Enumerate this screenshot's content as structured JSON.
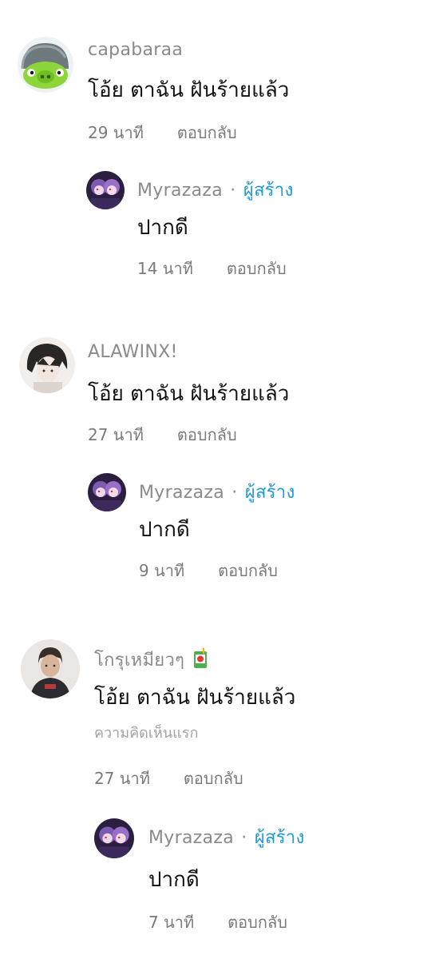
{
  "colors": {
    "creator": "#1e9bd7",
    "muted": "#8a8a8a",
    "text": "#111111"
  },
  "threads": [
    {
      "user": "capabaraa",
      "avatar_icon": "green-pig-helmet-avatar",
      "text": "โอ้ย ตาฉัน ฝันร้ายแล้ว",
      "time": "29 นาที",
      "reply_label": "ตอบกลับ",
      "reply": {
        "user": "Myrazaza",
        "separator": "·",
        "role": "ผู้สร้าง",
        "text": "ปากดี",
        "time": "14 นาที",
        "reply_label": "ตอบกลับ"
      }
    },
    {
      "user": "ALAWINX!",
      "avatar_icon": "anime-boy-avatar",
      "text": "โอ้ย ตาฉัน ฝันร้ายแล้ว",
      "time": "27 นาที",
      "reply_label": "ตอบกลับ",
      "reply": {
        "user": "Myrazaza",
        "separator": "·",
        "role": "ผู้สร้าง",
        "text": "ปากดี",
        "time": "9 นาที",
        "reply_label": "ตอบกลับ"
      }
    },
    {
      "user": "โกรุเหมียวๆ",
      "user_badge_icon": "juice-box-icon",
      "avatar_icon": "person-photo-avatar",
      "text": "โอ้ย ตาฉัน ฝันร้ายแล้ว",
      "badge": "ความคิดเห็นแรก",
      "time": "27 นาที",
      "reply_label": "ตอบกลับ",
      "reply": {
        "user": "Myrazaza",
        "separator": "·",
        "role": "ผู้สร้าง",
        "text": "ปากดี",
        "time": "7 นาที",
        "reply_label": "ตอบกลับ"
      }
    }
  ]
}
